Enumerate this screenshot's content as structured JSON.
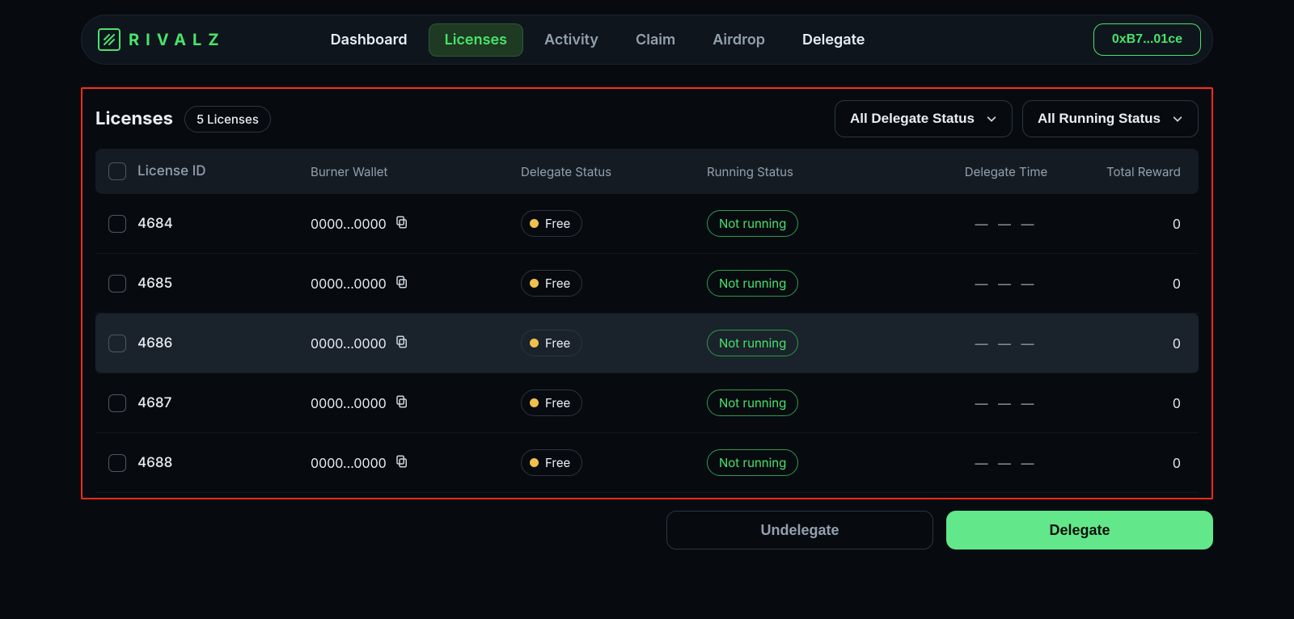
{
  "brand": {
    "name": "RIVALZ"
  },
  "nav": {
    "items": [
      {
        "label": "Dashboard",
        "strong": true
      },
      {
        "label": "Licenses",
        "active": true
      },
      {
        "label": "Activity"
      },
      {
        "label": "Claim"
      },
      {
        "label": "Airdrop"
      },
      {
        "label": "Delegate",
        "strong": true
      }
    ]
  },
  "wallet": {
    "short": "0xB7...01ce"
  },
  "page": {
    "title": "Licenses",
    "count_label": "5 Licenses",
    "filters": {
      "delegate": "All Delegate Status",
      "running": "All Running Status"
    },
    "columns": {
      "license_id": "License ID",
      "burner": "Burner Wallet",
      "delegate_status": "Delegate Status",
      "running_status": "Running Status",
      "delegate_time": "Delegate Time",
      "total_reward": "Total Reward"
    },
    "rows": [
      {
        "id": "4684",
        "burner": "0000...0000",
        "delegate_status": "Free",
        "running_status": "Not running",
        "delegate_time": "— — —",
        "total_reward": "0"
      },
      {
        "id": "4685",
        "burner": "0000...0000",
        "delegate_status": "Free",
        "running_status": "Not running",
        "delegate_time": "— — —",
        "total_reward": "0"
      },
      {
        "id": "4686",
        "burner": "0000...0000",
        "delegate_status": "Free",
        "running_status": "Not running",
        "delegate_time": "— — —",
        "total_reward": "0",
        "highlight": true
      },
      {
        "id": "4687",
        "burner": "0000...0000",
        "delegate_status": "Free",
        "running_status": "Not running",
        "delegate_time": "— — —",
        "total_reward": "0"
      },
      {
        "id": "4688",
        "burner": "0000...0000",
        "delegate_status": "Free",
        "running_status": "Not running",
        "delegate_time": "— — —",
        "total_reward": "0"
      }
    ],
    "actions": {
      "undelegate": "Undelegate",
      "delegate": "Delegate"
    }
  }
}
